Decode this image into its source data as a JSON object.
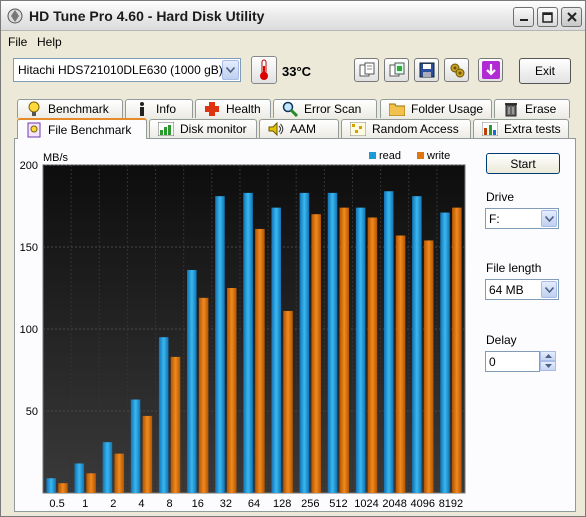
{
  "window": {
    "title": "HD Tune Pro 4.60 - Hard Disk Utility",
    "controls": {
      "minimize": "_",
      "maximize": "□",
      "close": "×"
    }
  },
  "menu": {
    "file": "File",
    "help": "Help"
  },
  "toolbar": {
    "drive": "Hitachi HDS721010DLE630 (1000 gB)",
    "temperature": "33°C",
    "exit_label": "Exit",
    "icons": [
      "copy-info-icon",
      "copy-screen-icon",
      "save-icon",
      "options-icon",
      "download-icon"
    ]
  },
  "tabs_top": [
    {
      "label": "Benchmark",
      "icon": "bulb-icon"
    },
    {
      "label": "Info",
      "icon": "info-icon"
    },
    {
      "label": "Health",
      "icon": "health-cross-icon"
    },
    {
      "label": "Error Scan",
      "icon": "magnifier-icon"
    },
    {
      "label": "Folder Usage",
      "icon": "folder-icon"
    },
    {
      "label": "Erase",
      "icon": "trash-icon"
    }
  ],
  "tabs_bottom": [
    {
      "label": "File Benchmark",
      "icon": "file-bulb-icon",
      "active": true
    },
    {
      "label": "Disk monitor",
      "icon": "bar-monitor-icon"
    },
    {
      "label": "AAM",
      "icon": "speaker-icon"
    },
    {
      "label": "Random Access",
      "icon": "random-grid-icon"
    },
    {
      "label": "Extra tests",
      "icon": "extra-grid-icon"
    }
  ],
  "controls": {
    "start_label": "Start",
    "drive_label": "Drive",
    "drive_value": "F:",
    "file_length_label": "File length",
    "file_length_value": "64 MB",
    "delay_label": "Delay",
    "delay_value": "0"
  },
  "colors": {
    "read": "#1a9bd7",
    "write": "#e07610",
    "plot_bg": "#1a1a1a"
  },
  "chart_data": {
    "type": "bar",
    "ylabel": "MB/s",
    "ylim": [
      0,
      200
    ],
    "yticks": [
      50,
      100,
      150,
      200
    ],
    "grid": true,
    "legend_placement": "top-right",
    "categories": [
      "0.5",
      "1",
      "2",
      "4",
      "8",
      "16",
      "32",
      "64",
      "128",
      "256",
      "512",
      "1024",
      "2048",
      "4096",
      "8192"
    ],
    "series": [
      {
        "name": "read",
        "color": "#1a9bd7",
        "values": [
          9,
          18,
          31,
          57,
          95,
          136,
          181,
          183,
          174,
          183,
          183,
          174,
          184,
          181,
          171
        ]
      },
      {
        "name": "write",
        "color": "#e07610",
        "values": [
          6,
          12,
          24,
          47,
          83,
          119,
          125,
          161,
          111,
          170,
          174,
          168,
          157,
          154,
          174
        ]
      }
    ]
  }
}
